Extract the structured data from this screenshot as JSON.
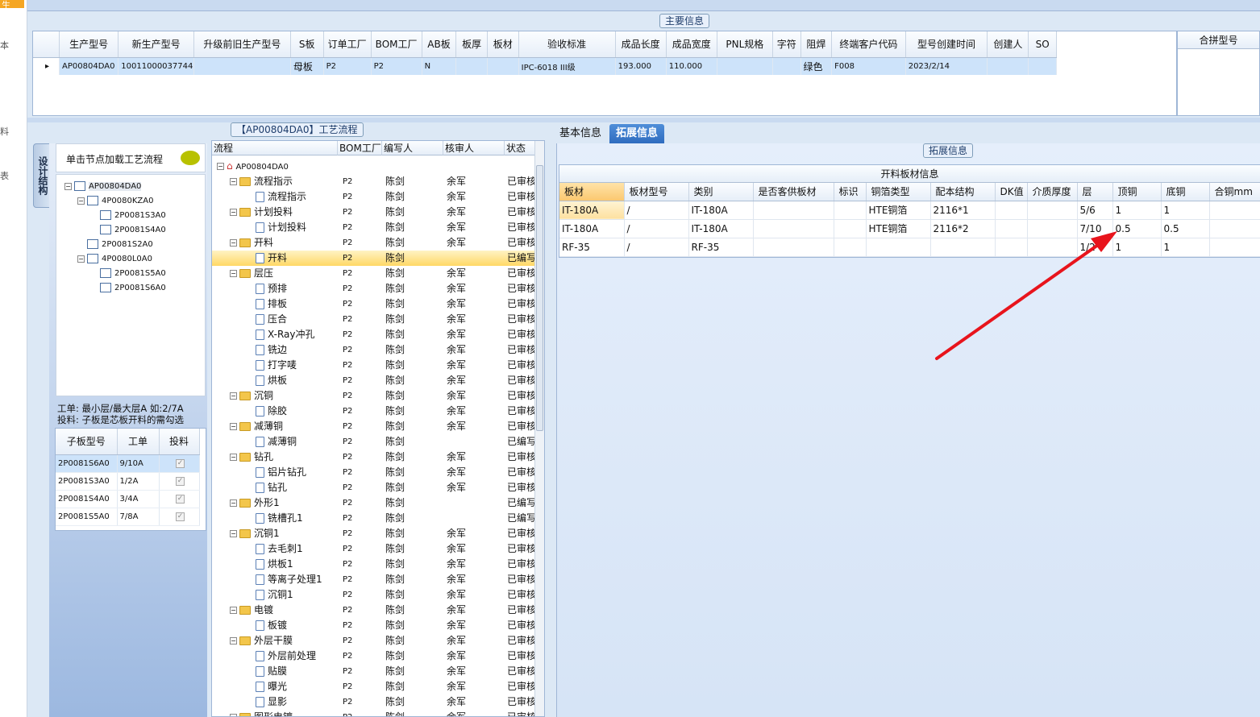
{
  "sidebar": {
    "chars": [
      "生",
      "本",
      "料",
      "表"
    ]
  },
  "main_info": {
    "title": "主要信息",
    "columns": [
      "",
      "生产型号",
      "新生产型号",
      "升级前旧生产型号",
      "S板",
      "订单工厂",
      "BOM工厂",
      "AB板",
      "板厚",
      "板材",
      "验收标准",
      "成品长度",
      "成品宽度",
      "PNL规格",
      "字符",
      "阻焊",
      "终端客户代码",
      "型号创建时间",
      "创建人",
      "SO"
    ],
    "row": [
      "▸",
      "AP00804DA0",
      "10011000037744",
      "",
      "母板",
      "P2",
      "P2",
      "N",
      "",
      "",
      "IPC-6018 III级",
      "193.000",
      "110.000",
      "",
      "",
      "绿色",
      "F008",
      "2023/2/14",
      "",
      ""
    ],
    "combine_header": "合拼型号"
  },
  "design_tab": "设计结构",
  "left_panel": {
    "header": "单击节点加载工艺流程",
    "tree": [
      "AP00804DA0",
      "4P0080KZA0",
      "2P0081S3A0",
      "2P0081S4A0",
      "2P0081S2A0",
      "4P0080L0A0",
      "2P0081S5A0",
      "2P0081S6A0"
    ],
    "note1": "工单: 最小层/最大层A 如:2/7A",
    "note2": "投料: 子板是芯板开料的需勾选",
    "sub_columns": [
      "子板型号",
      "工单",
      "投料"
    ],
    "sub_rows": [
      [
        "2P0081S6A0",
        "9/10A"
      ],
      [
        "2P0081S3A0",
        "1/2A"
      ],
      [
        "2P0081S4A0",
        "3/4A"
      ],
      [
        "2P0081S5A0",
        "7/8A"
      ]
    ]
  },
  "flow": {
    "title": "【AP00804DA0】工艺流程",
    "columns": [
      "流程",
      "BOM工厂",
      "编写人",
      "核审人",
      "状态"
    ],
    "root": "AP00804DA0",
    "rows": [
      {
        "name": "流程指示",
        "lvl": 1,
        "bom": "P2",
        "w": "陈剑",
        "r": "余军",
        "s": "已审核"
      },
      {
        "name": "流程指示",
        "lvl": 2,
        "bom": "P2",
        "w": "陈剑",
        "r": "余军",
        "s": "已审核"
      },
      {
        "name": "计划投料",
        "lvl": 1,
        "bom": "P2",
        "w": "陈剑",
        "r": "余军",
        "s": "已审核"
      },
      {
        "name": "计划投料",
        "lvl": 2,
        "bom": "P2",
        "w": "陈剑",
        "r": "余军",
        "s": "已审核"
      },
      {
        "name": "开料",
        "lvl": 1,
        "bom": "P2",
        "w": "陈剑",
        "r": "余军",
        "s": "已审核"
      },
      {
        "name": "开料",
        "lvl": 2,
        "bom": "P2",
        "w": "陈剑",
        "r": "",
        "s": "已编写",
        "sel": true
      },
      {
        "name": "层压",
        "lvl": 1,
        "bom": "P2",
        "w": "陈剑",
        "r": "余军",
        "s": "已审核"
      },
      {
        "name": "预排",
        "lvl": 2,
        "bom": "P2",
        "w": "陈剑",
        "r": "余军",
        "s": "已审核"
      },
      {
        "name": "排板",
        "lvl": 2,
        "bom": "P2",
        "w": "陈剑",
        "r": "余军",
        "s": "已审核"
      },
      {
        "name": "压合",
        "lvl": 2,
        "bom": "P2",
        "w": "陈剑",
        "r": "余军",
        "s": "已审核"
      },
      {
        "name": "X-Ray冲孔",
        "lvl": 2,
        "bom": "P2",
        "w": "陈剑",
        "r": "余军",
        "s": "已审核"
      },
      {
        "name": "铣边",
        "lvl": 2,
        "bom": "P2",
        "w": "陈剑",
        "r": "余军",
        "s": "已审核"
      },
      {
        "name": "打字唛",
        "lvl": 2,
        "bom": "P2",
        "w": "陈剑",
        "r": "余军",
        "s": "已审核"
      },
      {
        "name": "烘板",
        "lvl": 2,
        "bom": "P2",
        "w": "陈剑",
        "r": "余军",
        "s": "已审核"
      },
      {
        "name": "沉铜",
        "lvl": 1,
        "bom": "P2",
        "w": "陈剑",
        "r": "余军",
        "s": "已审核"
      },
      {
        "name": "除胶",
        "lvl": 2,
        "bom": "P2",
        "w": "陈剑",
        "r": "余军",
        "s": "已审核"
      },
      {
        "name": "减薄铜",
        "lvl": 1,
        "bom": "P2",
        "w": "陈剑",
        "r": "余军",
        "s": "已审核"
      },
      {
        "name": "减薄铜",
        "lvl": 2,
        "bom": "P2",
        "w": "陈剑",
        "r": "",
        "s": "已编写"
      },
      {
        "name": "钻孔",
        "lvl": 1,
        "bom": "P2",
        "w": "陈剑",
        "r": "余军",
        "s": "已审核"
      },
      {
        "name": "铝片钻孔",
        "lvl": 2,
        "bom": "P2",
        "w": "陈剑",
        "r": "余军",
        "s": "已审核"
      },
      {
        "name": "钻孔",
        "lvl": 2,
        "bom": "P2",
        "w": "陈剑",
        "r": "余军",
        "s": "已审核"
      },
      {
        "name": "外形1",
        "lvl": 1,
        "bom": "P2",
        "w": "陈剑",
        "r": "",
        "s": "已编写"
      },
      {
        "name": "铣槽孔1",
        "lvl": 2,
        "bom": "P2",
        "w": "陈剑",
        "r": "",
        "s": "已编写"
      },
      {
        "name": "沉铜1",
        "lvl": 1,
        "bom": "P2",
        "w": "陈剑",
        "r": "余军",
        "s": "已审核"
      },
      {
        "name": "去毛刺1",
        "lvl": 2,
        "bom": "P2",
        "w": "陈剑",
        "r": "余军",
        "s": "已审核"
      },
      {
        "name": "烘板1",
        "lvl": 2,
        "bom": "P2",
        "w": "陈剑",
        "r": "余军",
        "s": "已审核"
      },
      {
        "name": "等离子处理1",
        "lvl": 2,
        "bom": "P2",
        "w": "陈剑",
        "r": "余军",
        "s": "已审核"
      },
      {
        "name": "沉铜1",
        "lvl": 2,
        "bom": "P2",
        "w": "陈剑",
        "r": "余军",
        "s": "已审核"
      },
      {
        "name": "电镀",
        "lvl": 1,
        "bom": "P2",
        "w": "陈剑",
        "r": "余军",
        "s": "已审核"
      },
      {
        "name": "板镀",
        "lvl": 2,
        "bom": "P2",
        "w": "陈剑",
        "r": "余军",
        "s": "已审核"
      },
      {
        "name": "外层干膜",
        "lvl": 1,
        "bom": "P2",
        "w": "陈剑",
        "r": "余军",
        "s": "已审核"
      },
      {
        "name": "外层前处理",
        "lvl": 2,
        "bom": "P2",
        "w": "陈剑",
        "r": "余军",
        "s": "已审核"
      },
      {
        "name": "贴膜",
        "lvl": 2,
        "bom": "P2",
        "w": "陈剑",
        "r": "余军",
        "s": "已审核"
      },
      {
        "name": "曝光",
        "lvl": 2,
        "bom": "P2",
        "w": "陈剑",
        "r": "余军",
        "s": "已审核"
      },
      {
        "name": "显影",
        "lvl": 2,
        "bom": "P2",
        "w": "陈剑",
        "r": "余军",
        "s": "已审核"
      },
      {
        "name": "图形电镀",
        "lvl": 1,
        "bom": "P2",
        "w": "陈剑",
        "r": "余军",
        "s": "已审核"
      }
    ]
  },
  "right": {
    "tabs": [
      "基本信息",
      "拓展信息"
    ],
    "section_title": "拓展信息",
    "grid_caption": "开料板材信息",
    "columns": [
      "板材",
      "板材型号",
      "类别",
      "是否客供板材",
      "标识",
      "铜箔类型",
      "配本结构",
      "DK值",
      "介质厚度",
      "层",
      "顶铜",
      "底铜",
      "合铜mm"
    ],
    "rows": [
      [
        "IT-180A",
        "/",
        "IT-180A",
        "",
        "",
        "HTE铜箔",
        "2116*1",
        "",
        "",
        "5/6",
        "1",
        "1",
        ""
      ],
      [
        "IT-180A",
        "/",
        "IT-180A",
        "",
        "",
        "HTE铜箔",
        "2116*2",
        "",
        "",
        "7/10",
        "0.5",
        "0.5",
        ""
      ],
      [
        "RF-35",
        "/",
        "RF-35",
        "",
        "",
        "",
        "",
        "",
        "",
        "1/2",
        "1",
        "1",
        ""
      ]
    ]
  },
  "annotation_color": "#e8141c"
}
